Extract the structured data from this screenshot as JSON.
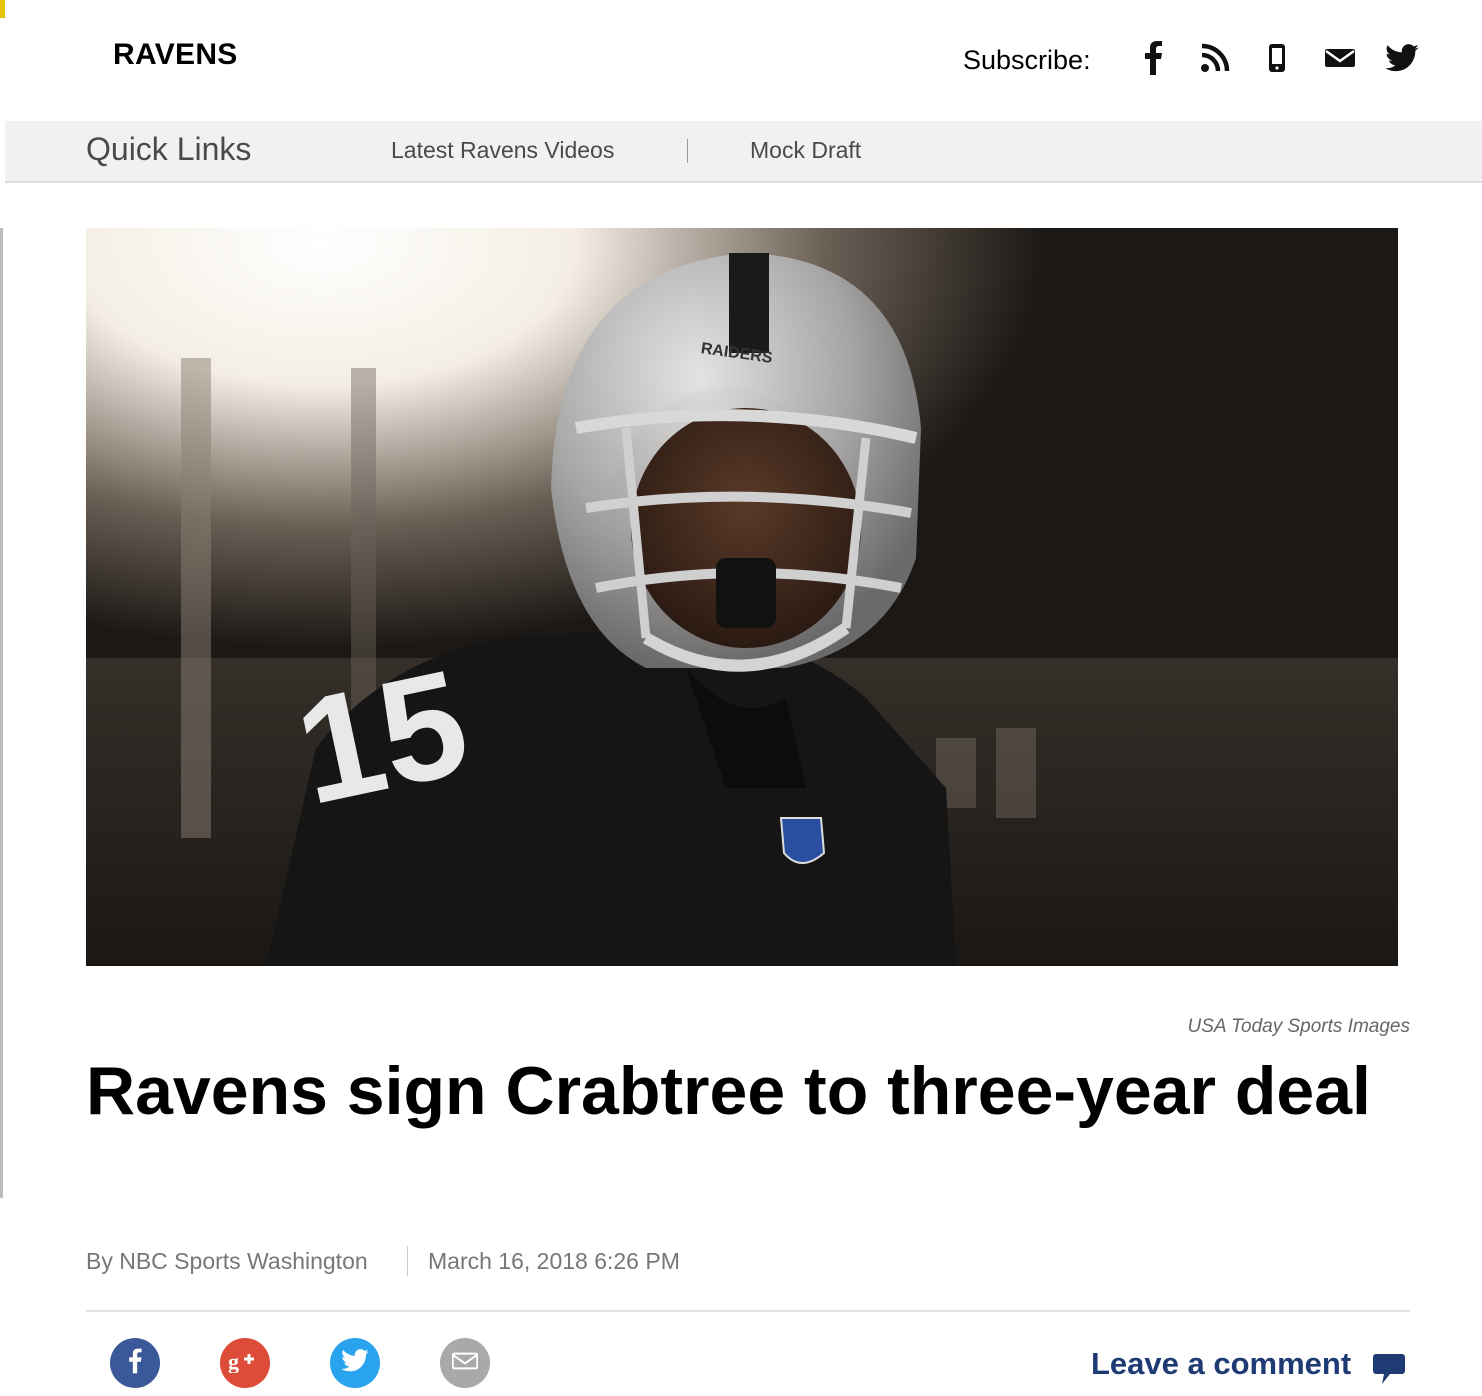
{
  "header": {
    "site_title": "RAVENS",
    "subscribe_label": "Subscribe:",
    "subscribe_icons": [
      "facebook-icon",
      "rss-icon",
      "mobile-icon",
      "email-icon",
      "twitter-icon"
    ]
  },
  "quick_links": {
    "title": "Quick Links",
    "items": [
      {
        "label": "Latest Ravens Videos"
      },
      {
        "label": "Mock Draft"
      }
    ]
  },
  "hero": {
    "helmet_text": "RAIDERS",
    "jersey_number": "15"
  },
  "article": {
    "photo_credit": "USA Today Sports Images",
    "headline": "Ravens sign Crabtree to three-year deal",
    "byline": "By NBC Sports Washington",
    "date": "March 16, 2018 6:26 PM"
  },
  "share": {
    "buttons": [
      "facebook-icon",
      "google-plus-icon",
      "twitter-icon",
      "email-icon"
    ],
    "colors": {
      "facebook": "#3b5998",
      "google_plus": "#dd4b39",
      "twitter": "#2aa3ef",
      "email": "#a9a9a9"
    },
    "comment_label": "Leave a comment",
    "comment_color": "#1f3b73"
  }
}
